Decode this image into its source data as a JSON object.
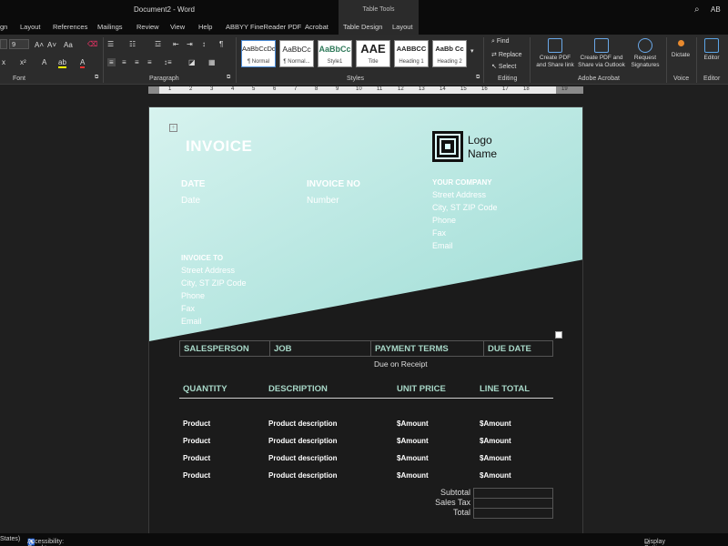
{
  "titlebar": {
    "document": "Document2  -  Word",
    "context_tools": "Table Tools",
    "user_initials": "AB"
  },
  "tabs": [
    "gn",
    "Layout",
    "References",
    "Mailings",
    "Review",
    "View",
    "Help",
    "ABBYY FineReader PDF",
    "Acrobat",
    "Table Design",
    "Layout"
  ],
  "ribbon": {
    "font_size": "9",
    "groups": {
      "font": "Font",
      "paragraph": "Paragraph",
      "styles": "Styles",
      "editing": "Editing",
      "acrobat": "Adobe Acrobat",
      "voice": "Voice",
      "editor": "Editor"
    },
    "styles": [
      {
        "sample": "AaBbCcDd",
        "name": "¶ Normal"
      },
      {
        "sample": "AaBbCc",
        "name": "¶ Normal..."
      },
      {
        "sample": "AaBbCc",
        "name": "Style1"
      },
      {
        "sample": "AAE",
        "name": "Title"
      },
      {
        "sample": "AABBCC",
        "name": "Heading 1"
      },
      {
        "sample": "AaBb Cc",
        "name": "Heading 2"
      }
    ],
    "editing": {
      "find": "Find",
      "replace": "Replace",
      "select": "Select"
    },
    "acrobat": {
      "create_share": "Create PDF and Share link",
      "create_outlook": "Create PDF and Share via Outlook",
      "request_sig": "Request Signatures"
    },
    "dictate": "Dictate",
    "editor": "Editor"
  },
  "ruler": [
    "1",
    "2",
    "3",
    "4",
    "5",
    "6",
    "7",
    "8",
    "9",
    "10",
    "11",
    "12",
    "13",
    "14",
    "15",
    "16",
    "17",
    "18",
    "19"
  ],
  "invoice": {
    "title": "INVOICE",
    "logo": "Logo Name",
    "date_label": "DATE",
    "date_value": "Date",
    "invoice_no_label": "INVOICE NO",
    "invoice_no_value": "Number",
    "company_label": "YOUR COMPANY",
    "company_lines": [
      "Street Address",
      "City, ST ZIP Code",
      "Phone",
      "Fax",
      "Email"
    ],
    "invoice_to_label": "INVOICE TO",
    "invoice_to_lines": [
      "Street Address",
      "City, ST ZIP Code",
      "Phone",
      "Fax",
      "Email"
    ],
    "header_cols": [
      "SALESPERSON",
      "JOB",
      "PAYMENT TERMS",
      "DUE DATE"
    ],
    "payment_terms_value": "Due on Receipt",
    "item_cols": [
      "QUANTITY",
      "DESCRIPTION",
      "UNIT PRICE",
      "LINE TOTAL"
    ],
    "rows": [
      [
        "Product",
        "Product description",
        "$Amount",
        "$Amount"
      ],
      [
        "Product",
        "Product description",
        "$Amount",
        "$Amount"
      ],
      [
        "Product",
        "Product description",
        "$Amount",
        "$Amount"
      ],
      [
        "Product",
        "Product description",
        "$Amount",
        "$Amount"
      ]
    ],
    "totals": [
      "Subtotal",
      "Sales Tax",
      "Total"
    ]
  },
  "status": {
    "left": "States)",
    "accessibility": "Accessibility: Good to go",
    "display": "Display Settings"
  },
  "colors": {
    "accent_teal": "#a8d8c8",
    "page_gradient_start": "#d6f2ee",
    "page_gradient_end": "#9fdcd6"
  }
}
